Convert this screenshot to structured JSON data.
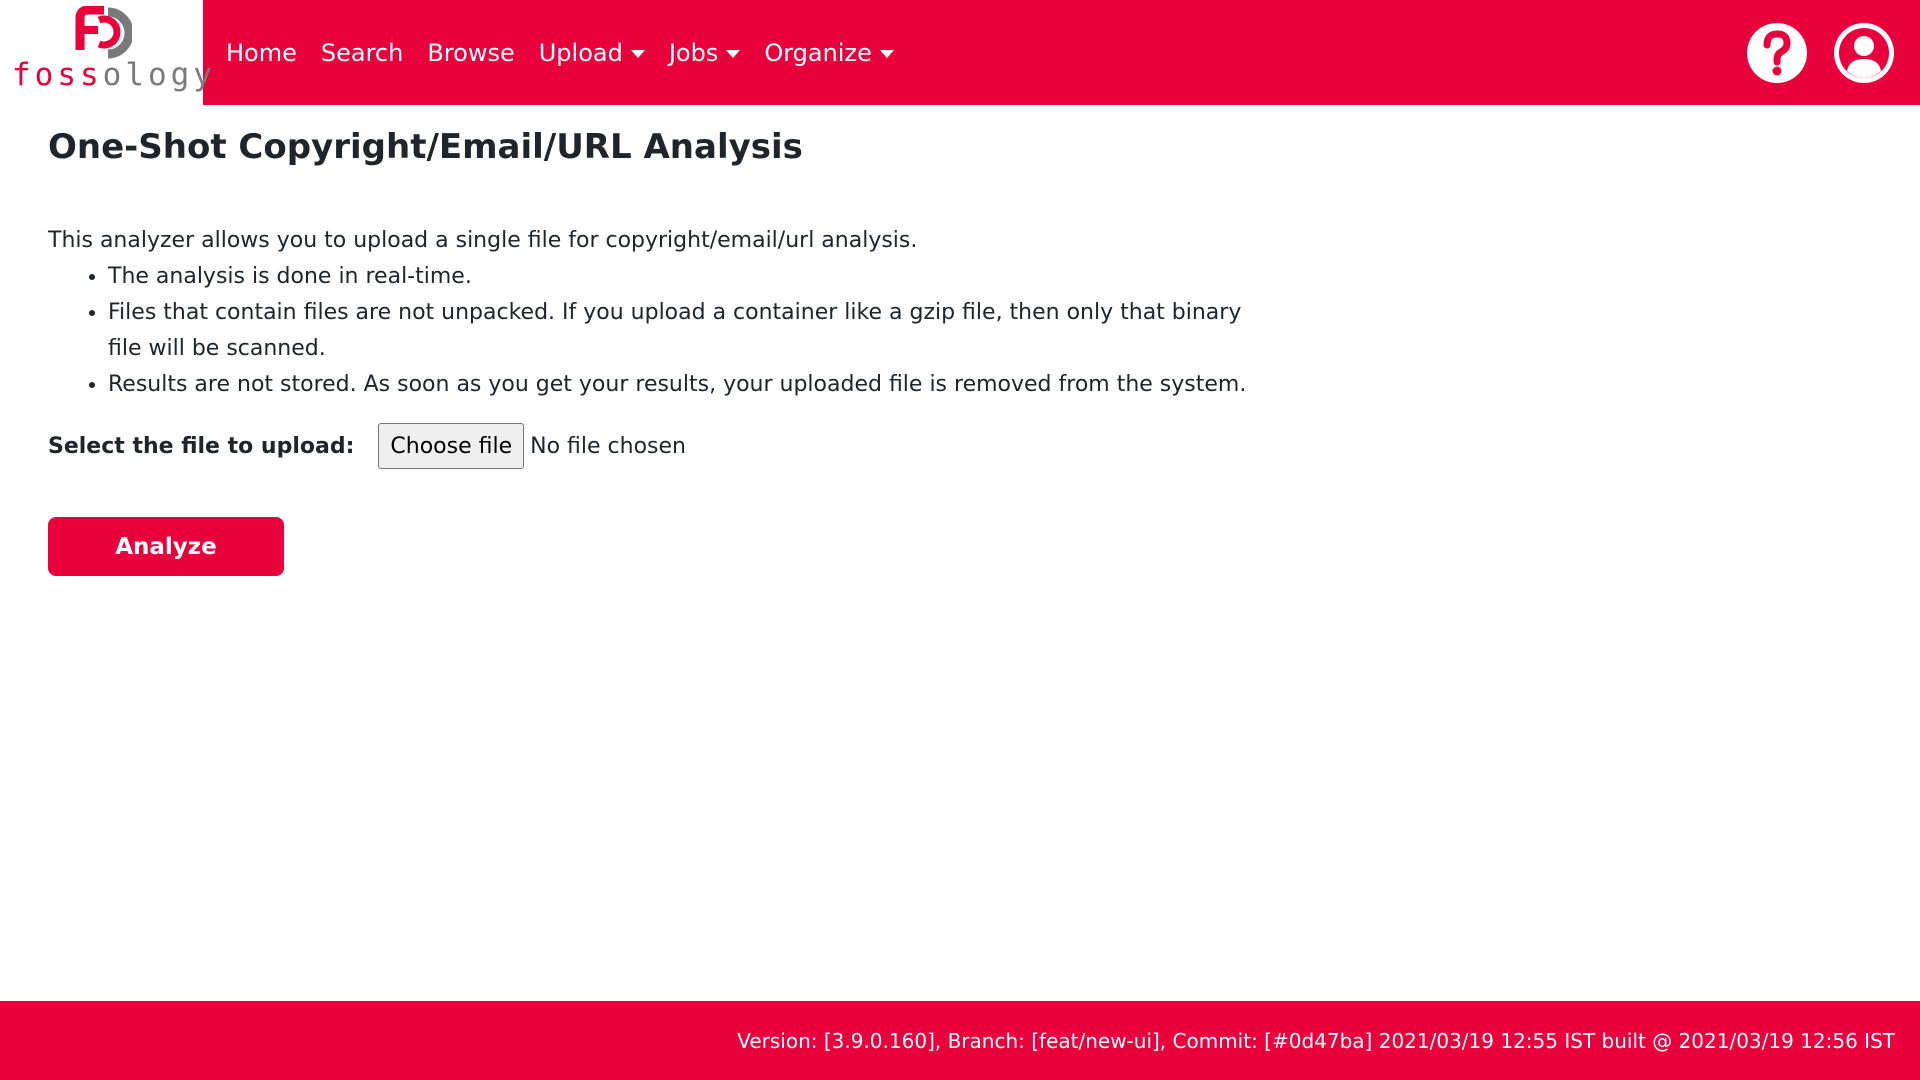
{
  "brand": {
    "name_part1": "foss",
    "name_part2": "ology",
    "logo_icon": "fossology-logo-icon"
  },
  "nav": {
    "items": [
      {
        "label": "Home",
        "dropdown": false
      },
      {
        "label": "Search",
        "dropdown": false
      },
      {
        "label": "Browse",
        "dropdown": false
      },
      {
        "label": "Upload",
        "dropdown": true
      },
      {
        "label": "Jobs",
        "dropdown": true
      },
      {
        "label": "Organize",
        "dropdown": true
      }
    ],
    "right_icons": [
      "help-icon",
      "user-account-icon"
    ]
  },
  "page": {
    "title": "One-Shot Copyright/Email/URL Analysis",
    "intro": "This analyzer allows you to upload a single file for copyright/email/url analysis.",
    "bullets": [
      "The analysis is done in real-time.",
      "Files that contain files are not unpacked. If you upload a container like a gzip file, then only that binary file will be scanned.",
      "Results are not stored. As soon as you get your results, your uploaded file is removed from the system."
    ]
  },
  "upload": {
    "label": "Select the file to upload:",
    "button_label": "Choose file",
    "status": "No file chosen"
  },
  "actions": {
    "analyze_label": "Analyze"
  },
  "footer": {
    "text": "Version: [3.9.0.160], Branch: [feat/new-ui], Commit: [#0d47ba] 2021/03/19 12:55 IST built @ 2021/03/19 12:56 IST"
  },
  "colors": {
    "brand": "#e8003d",
    "logo_gray": "#7a7a7a",
    "text": "#212529"
  }
}
